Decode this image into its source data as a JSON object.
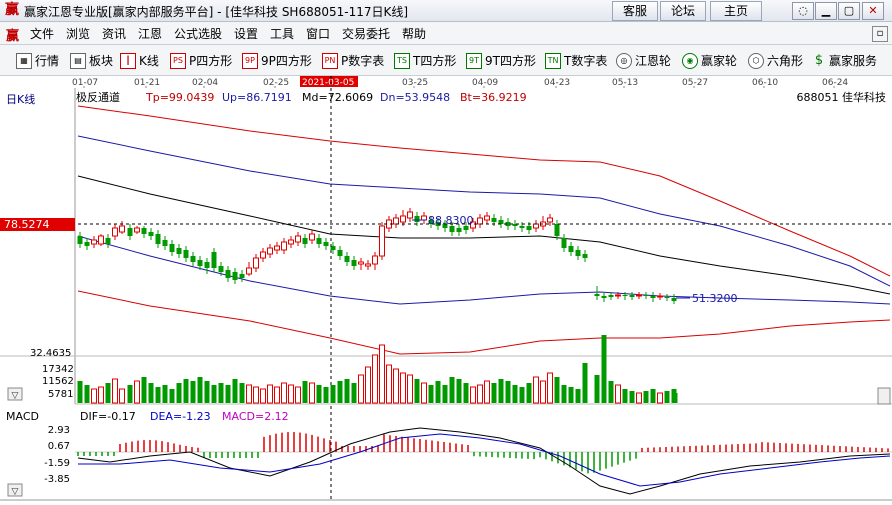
{
  "window": {
    "app_icon": "赢",
    "title": "赢家江恩专业版[赢家内部服务平台] - [佳华科技  SH688051-117日K线]",
    "buttons": [
      "客服",
      "论坛",
      "主页"
    ]
  },
  "menu": {
    "app_icon": "赢",
    "items": [
      "文件",
      "浏览",
      "资讯",
      "江恩",
      "公式选股",
      "设置",
      "工具",
      "窗口",
      "交易委托",
      "帮助"
    ]
  },
  "toolbar": {
    "items": [
      {
        "label": "行情",
        "icon": "grid-icon"
      },
      {
        "label": "板块",
        "icon": "blocks-icon"
      },
      {
        "label": "K线",
        "icon": "candlestick-icon"
      },
      {
        "label": "P四方形",
        "icon": "p-square-icon"
      },
      {
        "label": "9P四方形",
        "icon": "9p-square-icon"
      },
      {
        "label": "P数字表",
        "icon": "p-table-icon"
      },
      {
        "label": "T四方形",
        "icon": "t-square-icon"
      },
      {
        "label": "9T四方形",
        "icon": "9t-square-icon"
      },
      {
        "label": "T数字表",
        "icon": "t-table-icon"
      },
      {
        "label": "江恩轮",
        "icon": "gann-wheel-icon"
      },
      {
        "label": "赢家轮",
        "icon": "winner-wheel-icon"
      },
      {
        "label": "六角形",
        "icon": "hexagon-icon"
      },
      {
        "label": "赢家服务",
        "icon": "dollar-icon"
      }
    ]
  },
  "chart_header": {
    "period": "日K线",
    "indicator": "极反通道",
    "tp": "Tp=99.0439",
    "up": "Up=86.7191",
    "md": "Md=72.6069",
    "dn": "Dn=53.9548",
    "bt": "Bt=36.9219",
    "code_name": "688051  佳华科技"
  },
  "date_axis": {
    "labels": [
      "01-07",
      "01-21",
      "02-04",
      "02-25",
      "2021-03-05",
      "03-25",
      "04-09",
      "04-23",
      "05-13",
      "05-27",
      "06-10",
      "06-24"
    ],
    "highlight": "2021-03-05"
  },
  "price": {
    "cursor_label": "78.5274",
    "high_label": "88.8300",
    "low_label": "51.3200"
  },
  "volume": {
    "axis_labels": [
      "32.4635",
      "17342",
      "11562",
      "5781"
    ]
  },
  "macd": {
    "title": "MACD",
    "dif": "DIF=-0.17",
    "dea": "DEA=-1.23",
    "macd": "MACD=2.12",
    "axis_labels": [
      "2.93",
      "0.67",
      "-1.59",
      "-3.85"
    ]
  },
  "colors": {
    "up": "#e00000",
    "down": "#009a00",
    "channel_outer": "#d80000",
    "channel_mid": "#1a1aa8",
    "channel_center": "#000000",
    "dea_line": "#0000c8",
    "dif_line": "#000000",
    "cursor_label_bg": "#e00000"
  }
}
